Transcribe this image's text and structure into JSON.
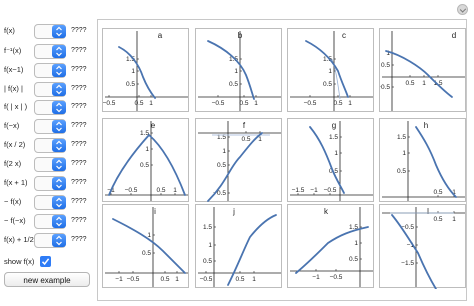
{
  "controls": [
    {
      "label": "f(x)",
      "value": "????"
    },
    {
      "label": "f⁻¹(x)",
      "value": "????"
    },
    {
      "label": "f(x−1)",
      "value": "????"
    },
    {
      "label": "| f(x) |",
      "value": "????"
    },
    {
      "label": "f( | x | )",
      "value": "????"
    },
    {
      "label": "f(−x)",
      "value": "????"
    },
    {
      "label": "f(x / 2)",
      "value": "????"
    },
    {
      "label": "f(2 x)",
      "value": "????"
    },
    {
      "label": "f(x + 1)",
      "value": "????"
    },
    {
      "label": "− f(x)",
      "value": "????"
    },
    {
      "label": "− f(−x)",
      "value": "????"
    },
    {
      "label": "f(x) + 1/2",
      "value": "????"
    }
  ],
  "show_fx": {
    "label": "show f(x)",
    "checked": true
  },
  "new_example_label": "new example",
  "colors": {
    "curve": "#4a74b0",
    "faint_curve": "#9bb3d6",
    "axis": "#222222",
    "accent": "#2f7cf6"
  },
  "plots": [
    {
      "label": "a",
      "xticks": [
        "−0.5",
        "0.5",
        "1"
      ],
      "yticks": [
        "1.5",
        "1",
        "0.5"
      ]
    },
    {
      "label": "b",
      "xticks": [
        "−0.5",
        "0.5",
        "1"
      ],
      "yticks": [
        "1.5",
        "1",
        "0.5"
      ]
    },
    {
      "label": "c",
      "xticks": [
        "−0.5",
        "0.5",
        "1"
      ],
      "yticks": [
        "1.5",
        "1",
        "0.5"
      ]
    },
    {
      "label": "d",
      "xticks": [
        "0.5",
        "1",
        "1.5"
      ],
      "yticks": [
        "1",
        "0.5",
        "−0.5"
      ]
    },
    {
      "label": "e",
      "xticks": [
        "−1",
        "−0.5",
        "0.5",
        "1"
      ],
      "yticks": [
        "1.5",
        "1",
        "0.5"
      ]
    },
    {
      "label": "f",
      "xticks": [
        "0.5",
        "1"
      ],
      "yticks": [
        "1.5",
        "1",
        "0.5",
        "−0.5"
      ]
    },
    {
      "label": "g",
      "xticks": [
        "−1.5",
        "−1",
        "−0.5"
      ],
      "yticks": [
        "1.5",
        "1",
        "0.5"
      ]
    },
    {
      "label": "h",
      "xticks": [
        "0.5",
        "1"
      ],
      "yticks": [
        "1.5",
        "1",
        "0.5"
      ]
    },
    {
      "label": "i",
      "xticks": [
        "−1",
        "−0.5",
        "0.5",
        "1"
      ],
      "yticks": [
        "1",
        "0.5"
      ]
    },
    {
      "label": "j",
      "xticks": [
        "−0.5",
        "0.5",
        "1"
      ],
      "yticks": [
        "1.5",
        "1",
        "0.5"
      ]
    },
    {
      "label": "k",
      "xticks": [
        "−1",
        "−0.5"
      ],
      "yticks": [
        "1.5",
        "1",
        "0.5"
      ]
    },
    {
      "label": "l",
      "xticks": [
        "0.5",
        "1"
      ],
      "yticks": [
        "−0.5",
        "−1",
        "−1.5"
      ]
    }
  ]
}
